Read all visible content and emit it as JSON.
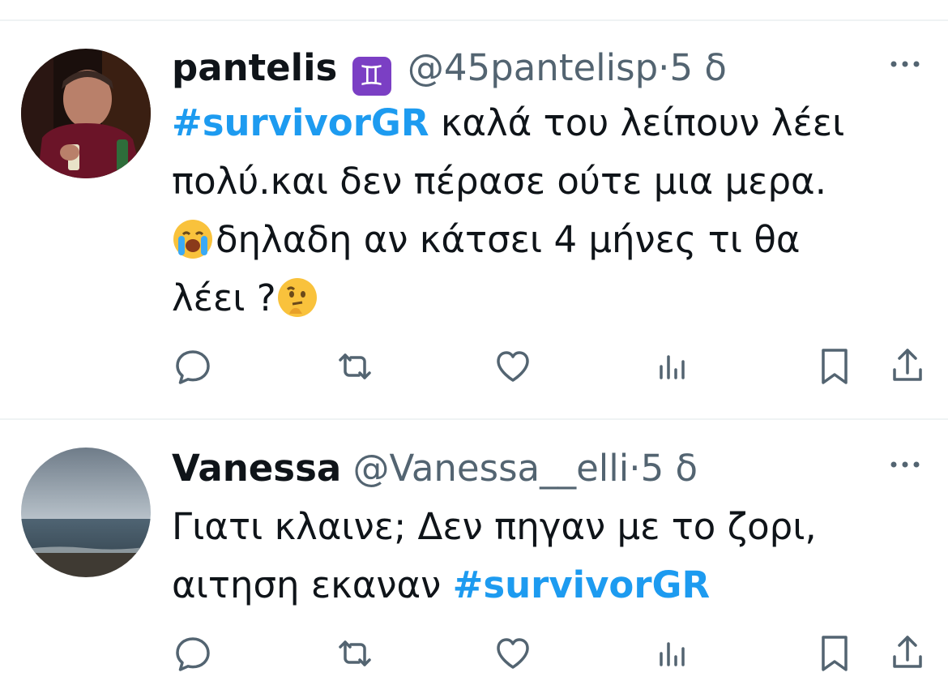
{
  "tweets": [
    {
      "name": "pantelis",
      "badge": "♊",
      "handle": "@45pantelisp",
      "separator": "·",
      "time": "5 δ",
      "hashtag": "#survivorGR",
      "text_line1": " καλά του λείπουν λέει",
      "text_line2": "πολύ.και δεν πέρασε ούτε μια μερα.",
      "emoji1": "loudly-crying-face",
      "text_line3": "δηλαδη αν κάτσει 4 μήνες τι θα",
      "text_line4": "λέει ?",
      "emoji2": "thinking-face"
    },
    {
      "name": "Vanessa",
      "handle": "@Vanessa__elli",
      "separator": "·",
      "time": "5 δ",
      "text_line1": "Γιατι κλαινε; Δεν πηγαν με το ζορι,",
      "text_line2_prefix": "αιτηση εκαναν ",
      "hashtag": "#survivorGR"
    }
  ],
  "icons": {
    "reply": "reply-icon",
    "retweet": "retweet-icon",
    "like": "like-icon",
    "views": "views-icon",
    "bookmark": "bookmark-icon",
    "share": "share-icon",
    "more": "more-icon"
  },
  "colors": {
    "accent": "#1d9bf0",
    "text": "#0f1419",
    "secondary": "#536471",
    "divider": "#eff3f4"
  }
}
